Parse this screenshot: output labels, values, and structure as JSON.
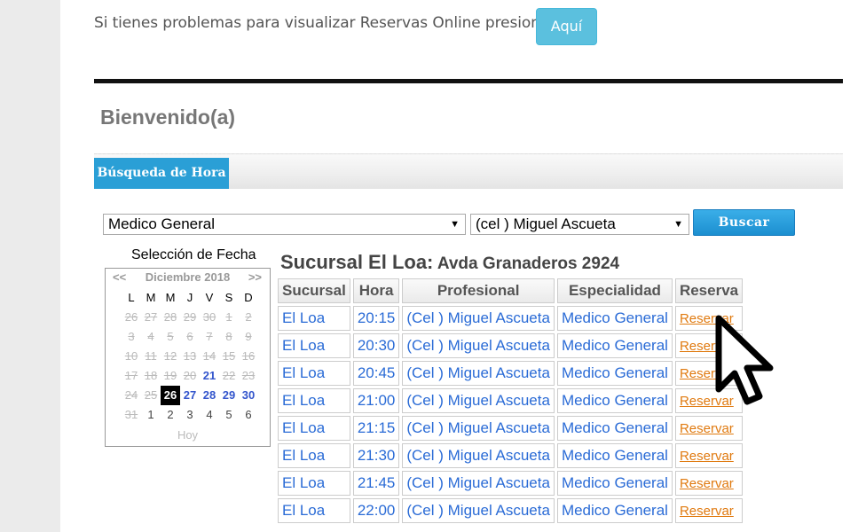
{
  "notice": {
    "text": "Si tienes problemas para visualizar Reservas Online presiona",
    "button_label": "Aquí",
    "button_color": "#5bc0de"
  },
  "welcome": "Bienvenido(a)",
  "tabs": [
    {
      "label": "Búsqueda de Hora",
      "active": true
    }
  ],
  "filters": {
    "specialty": "Medico General",
    "professional": "(cel ) Miguel Ascueta",
    "search_label": "Buscar"
  },
  "calendar": {
    "title": "Selección de Fecha",
    "prev": "<<",
    "next": ">>",
    "month": "Diciembre 2018",
    "weekdays": [
      "L",
      "M",
      "M",
      "J",
      "V",
      "S",
      "D"
    ],
    "weeks": [
      [
        {
          "d": "26",
          "s": "past"
        },
        {
          "d": "27",
          "s": "past"
        },
        {
          "d": "28",
          "s": "past"
        },
        {
          "d": "29",
          "s": "past"
        },
        {
          "d": "30",
          "s": "past"
        },
        {
          "d": "1",
          "s": "past"
        },
        {
          "d": "2",
          "s": "past"
        }
      ],
      [
        {
          "d": "3",
          "s": "past"
        },
        {
          "d": "4",
          "s": "past"
        },
        {
          "d": "5",
          "s": "past"
        },
        {
          "d": "6",
          "s": "past"
        },
        {
          "d": "7",
          "s": "past"
        },
        {
          "d": "8",
          "s": "past"
        },
        {
          "d": "9",
          "s": "past"
        }
      ],
      [
        {
          "d": "10",
          "s": "past"
        },
        {
          "d": "11",
          "s": "past"
        },
        {
          "d": "12",
          "s": "past"
        },
        {
          "d": "13",
          "s": "past"
        },
        {
          "d": "14",
          "s": "past"
        },
        {
          "d": "15",
          "s": "past"
        },
        {
          "d": "16",
          "s": "past"
        }
      ],
      [
        {
          "d": "17",
          "s": "past"
        },
        {
          "d": "18",
          "s": "past"
        },
        {
          "d": "19",
          "s": "past"
        },
        {
          "d": "20",
          "s": "past"
        },
        {
          "d": "21",
          "s": "avail"
        },
        {
          "d": "22",
          "s": "past"
        },
        {
          "d": "23",
          "s": "past"
        }
      ],
      [
        {
          "d": "24",
          "s": "past"
        },
        {
          "d": "25",
          "s": "past"
        },
        {
          "d": "26",
          "s": "today"
        },
        {
          "d": "27",
          "s": "avail"
        },
        {
          "d": "28",
          "s": "avail"
        },
        {
          "d": "29",
          "s": "avail"
        },
        {
          "d": "30",
          "s": "avail"
        }
      ],
      [
        {
          "d": "31",
          "s": "past"
        },
        {
          "d": "1",
          "s": "next-month"
        },
        {
          "d": "2",
          "s": "next-month"
        },
        {
          "d": "3",
          "s": "next-month"
        },
        {
          "d": "4",
          "s": "next-month"
        },
        {
          "d": "5",
          "s": "next-month"
        },
        {
          "d": "6",
          "s": "next-month"
        }
      ]
    ],
    "today_label": "Hoy"
  },
  "branch": {
    "name": "Sucursal El Loa:",
    "address": "Avda Granaderos 2924"
  },
  "table": {
    "headers": [
      "Sucursal",
      "Hora",
      "Profesional",
      "Especialidad",
      "Reserva"
    ],
    "rows": [
      [
        "El Loa",
        "20:15",
        "(Cel ) Miguel Ascueta",
        "Medico General",
        "Reservar"
      ],
      [
        "El Loa",
        "20:30",
        "(Cel ) Miguel Ascueta",
        "Medico General",
        "Reservar"
      ],
      [
        "El Loa",
        "20:45",
        "(Cel ) Miguel Ascueta",
        "Medico General",
        "Reservar"
      ],
      [
        "El Loa",
        "21:00",
        "(Cel ) Miguel Ascueta",
        "Medico General",
        "Reservar"
      ],
      [
        "El Loa",
        "21:15",
        "(Cel ) Miguel Ascueta",
        "Medico General",
        "Reservar"
      ],
      [
        "El Loa",
        "21:30",
        "(Cel ) Miguel Ascueta",
        "Medico General",
        "Reservar"
      ],
      [
        "El Loa",
        "21:45",
        "(Cel ) Miguel Ascueta",
        "Medico General",
        "Reservar"
      ],
      [
        "El Loa",
        "22:00",
        "(Cel ) Miguel Ascueta",
        "Medico General",
        "Reservar"
      ]
    ]
  },
  "colors": {
    "accent": "#2a9fd6",
    "link": "#2a6bd6",
    "reserve_link": "#e07a10"
  },
  "icons": {
    "cursor": "arrow-cursor-icon"
  }
}
